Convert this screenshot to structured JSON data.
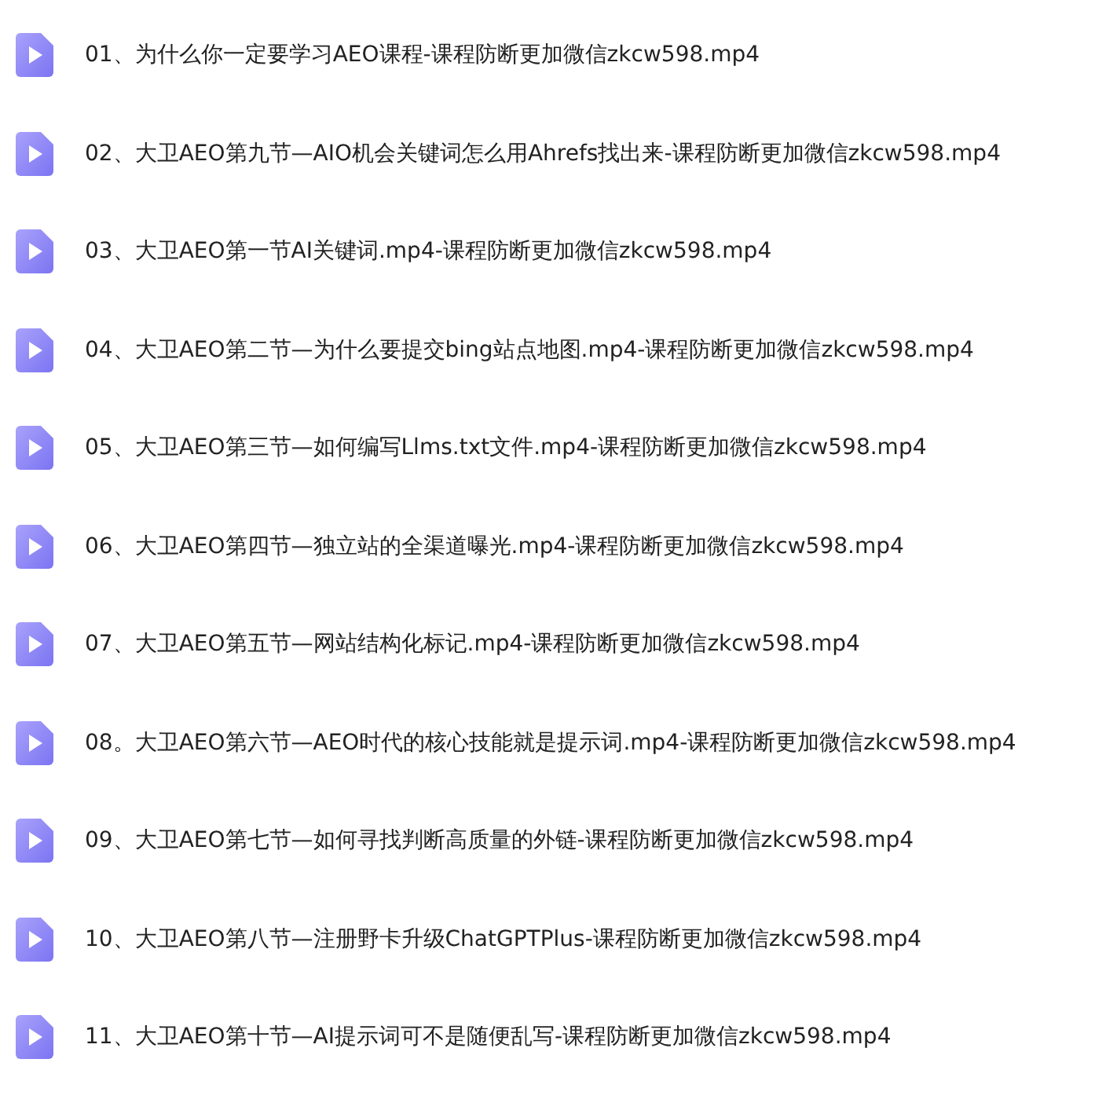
{
  "files": [
    {
      "name": "01、为什么你一定要学习AEO课程-课程防断更加微信zkcw598.mp4"
    },
    {
      "name": "02、大卫AEO第九节—AIO机会关键词怎么用Ahrefs找出来-课程防断更加微信zkcw598.mp4"
    },
    {
      "name": "03、大卫AEO第一节AI关键词.mp4-课程防断更加微信zkcw598.mp4"
    },
    {
      "name": "04、大卫AEO第二节—为什么要提交bing站点地图.mp4-课程防断更加微信zkcw598.mp4"
    },
    {
      "name": "05、大卫AEO第三节—如何编写Llms.txt文件.mp4-课程防断更加微信zkcw598.mp4"
    },
    {
      "name": "06、大卫AEO第四节—独立站的全渠道曝光.mp4-课程防断更加微信zkcw598.mp4"
    },
    {
      "name": "07、大卫AEO第五节—网站结构化标记.mp4-课程防断更加微信zkcw598.mp4"
    },
    {
      "name": "08。大卫AEO第六节—AEO时代的核心技能就是提示词.mp4-课程防断更加微信zkcw598.mp4"
    },
    {
      "name": "09、大卫AEO第七节—如何寻找判断高质量的外链-课程防断更加微信zkcw598.mp4"
    },
    {
      "name": "10、大卫AEO第八节—注册野卡升级ChatGPTPlus-课程防断更加微信zkcw598.mp4"
    },
    {
      "name": "11、大卫AEO第十节—AI提示词可不是随便乱写-课程防断更加微信zkcw598.mp4"
    }
  ]
}
